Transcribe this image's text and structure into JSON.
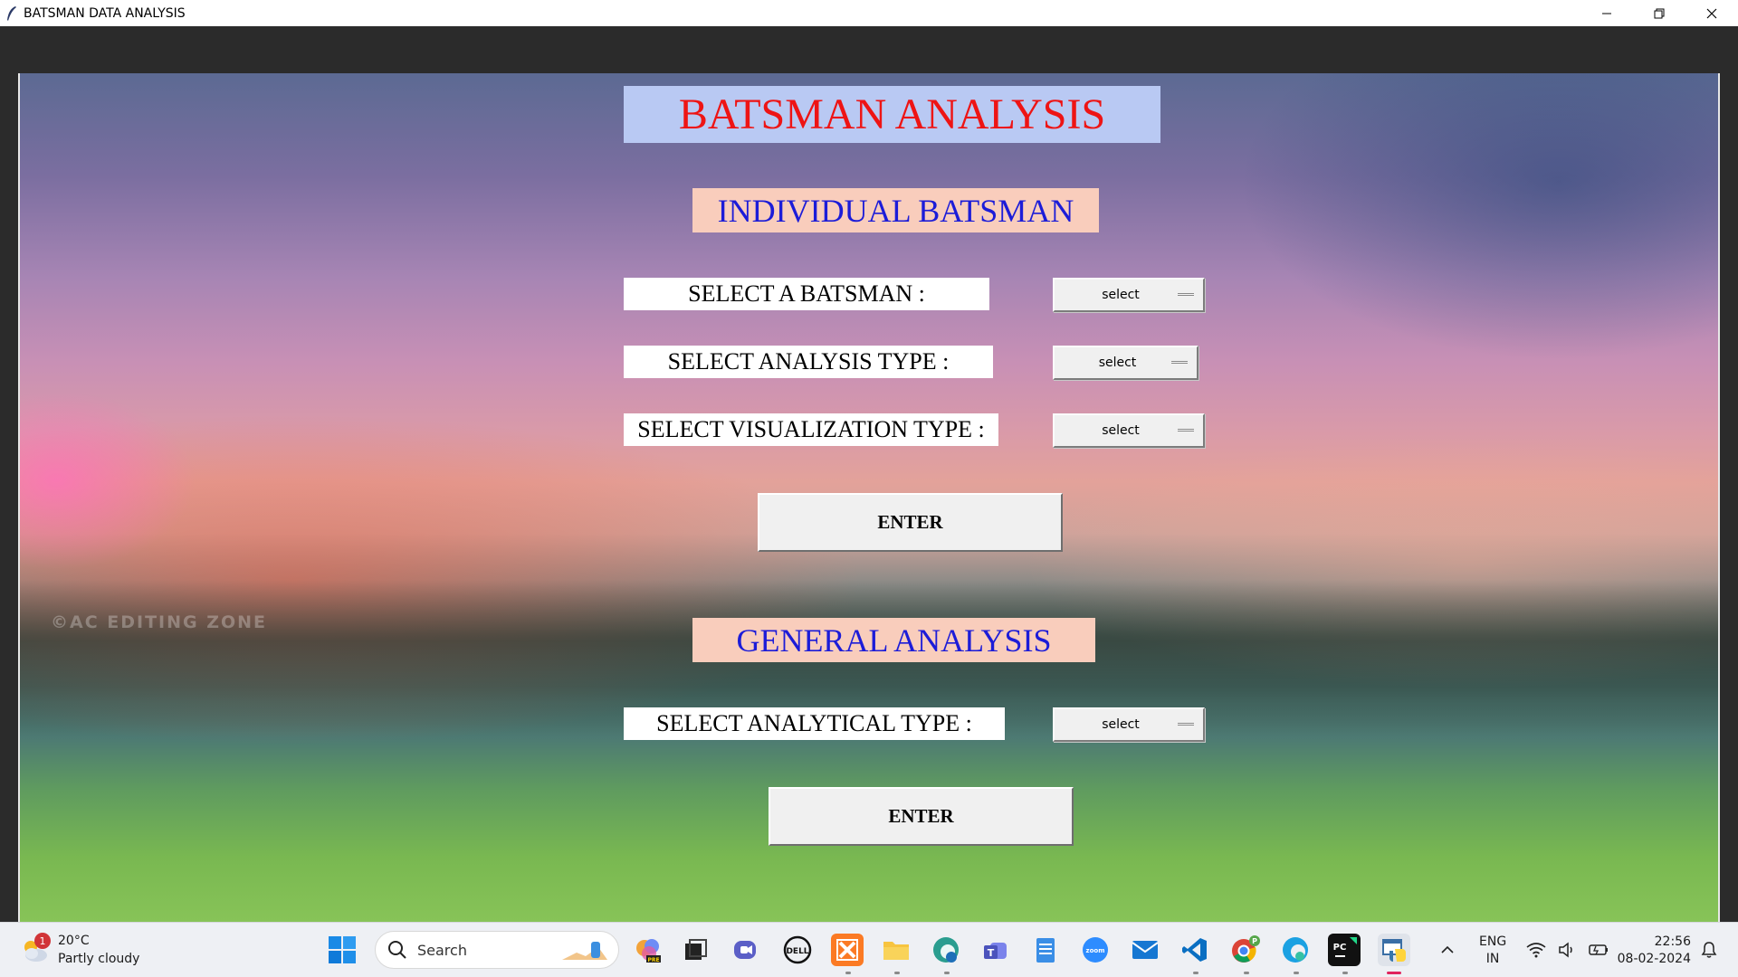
{
  "window": {
    "title": "BATSMAN DATA ANALYSIS"
  },
  "app": {
    "main_title": "BATSMAN  ANALYSIS",
    "individual_section": {
      "title": "INDIVIDUAL BATSMAN",
      "fields": [
        {
          "label": "SELECT  A  BATSMAN  :",
          "value": "select"
        },
        {
          "label": "SELECT  ANALYSIS  TYPE  :",
          "value": "select"
        },
        {
          "label": "SELECT  VISUALIZATION  TYPE :",
          "value": "select"
        }
      ],
      "enter_label": "ENTER"
    },
    "general_section": {
      "title": "GENERAL ANALYSIS",
      "fields": [
        {
          "label": "SELECT  ANALYTICAL  TYPE :",
          "value": "select"
        }
      ],
      "enter_label": "ENTER"
    },
    "background_watermark": "©AC EDITING ZONE"
  },
  "colors": {
    "main_title_bg": "#b9c9f3",
    "main_title_text": "#ee1414",
    "section_bg": "#f9cdbc",
    "section_text": "#1c1cd8"
  },
  "taskbar": {
    "weather": {
      "temp": "20°C",
      "condition": "Partly cloudy",
      "badge": "1"
    },
    "search_placeholder": "Search",
    "pinned_icons": [
      "copilot-pre-icon",
      "task-view-icon",
      "teams-chat-icon",
      "dell-icon",
      "xampp-icon",
      "file-explorer-icon",
      "edge-beta-icon",
      "teams-icon",
      "notepad-icon",
      "zoom-icon",
      "mail-icon",
      "vscode-icon",
      "chrome-icon",
      "edge-icon",
      "pycharm-icon",
      "python-idle-icon"
    ],
    "tray": {
      "lang_line1": "ENG",
      "lang_line2": "IN",
      "time": "22:56",
      "date": "08-02-2024"
    }
  }
}
